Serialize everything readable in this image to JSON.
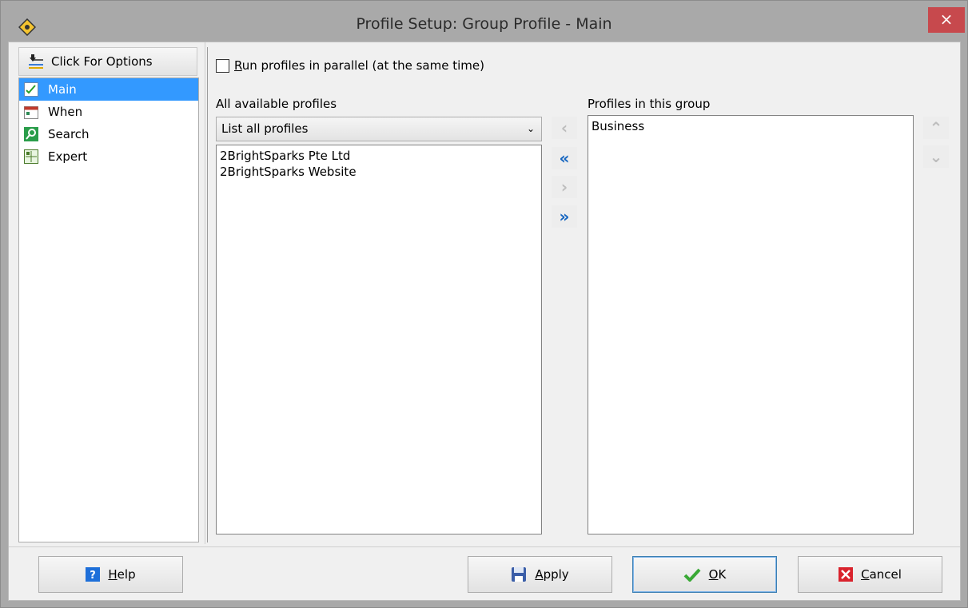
{
  "window": {
    "title": "Profile Setup: Group Profile - Main",
    "close_glyph": "×"
  },
  "sidebar": {
    "options_button": "Click For Options",
    "items": [
      {
        "label": "Main",
        "icon": "main-checklist-icon",
        "active": true
      },
      {
        "label": "When",
        "icon": "calendar-icon",
        "active": false
      },
      {
        "label": "Search",
        "icon": "search-icon",
        "active": false
      },
      {
        "label": "Expert",
        "icon": "expert-grid-icon",
        "active": false
      }
    ]
  },
  "main": {
    "parallel_checkbox": {
      "accel": "R",
      "rest": "un profiles in parallel (at the same time)",
      "checked": false
    },
    "available_label": "All available profiles",
    "filter_select": {
      "value": "List all profiles",
      "caret": "⌄"
    },
    "available_profiles": [
      "2BrightSparks Pte Ltd",
      "2BrightSparks Website"
    ],
    "group_label": "Profiles in this group",
    "group_profiles": [
      "Business"
    ],
    "transfer_buttons": {
      "move_left": "‹",
      "move_all_left": "«",
      "move_right": "›",
      "move_all_right": "»"
    },
    "order_buttons": {
      "up": "⌃",
      "down": "⌄"
    }
  },
  "footer": {
    "help": {
      "accel": "H",
      "rest": "elp"
    },
    "apply": {
      "accel": "A",
      "rest": "pply"
    },
    "ok": {
      "accel": "O",
      "rest": "K"
    },
    "cancel": {
      "accel": "C",
      "rest": "ancel"
    }
  },
  "colors": {
    "selection": "#3399ff",
    "close": "#c7494d",
    "arrow_blue": "#1565c0"
  }
}
